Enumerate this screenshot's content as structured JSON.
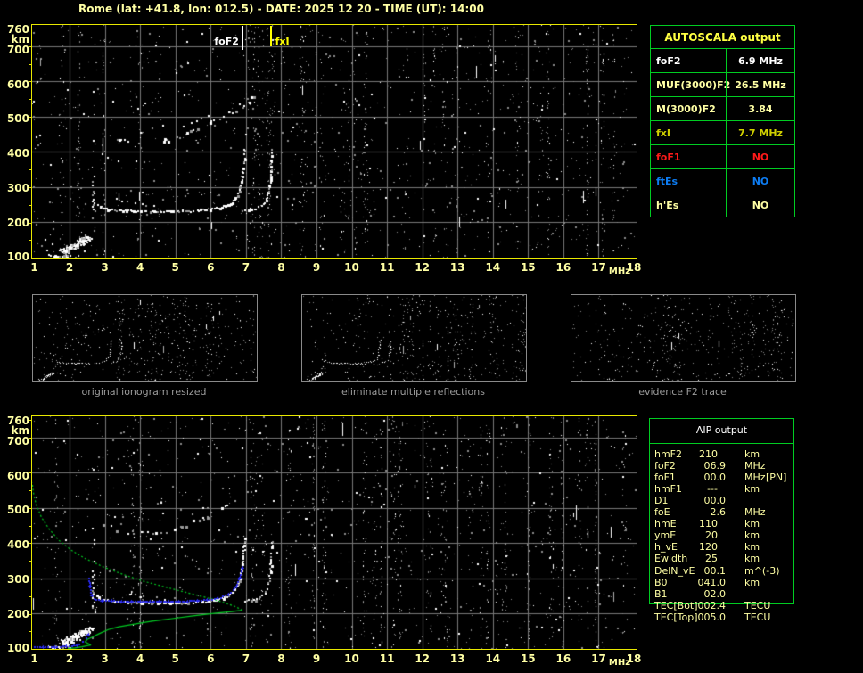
{
  "title": "Rome (lat: +41.8, lon: 012.5) - DATE: 2025 12 20 - TIME (UT): 14:00",
  "colors": {
    "background": "#000000",
    "panel_border": "#e8e800",
    "axis_label": "#ffffa4",
    "grid": "#787878",
    "table_border": "#00cc22",
    "profile_green": "#00cc22",
    "restored_blue": "#2a2af0",
    "caption_gray": "#9c9c9c",
    "thumb_border": "#8a8a8a",
    "trace_white": "#ffffff",
    "trace_gray": "#9a9a9a"
  },
  "autoscala_table": {
    "title": "AUTOSCALA output",
    "title_color": "#ffff42",
    "rows": [
      {
        "label": "foF2",
        "value": "6.9 MHz",
        "color": "#ffffff"
      },
      {
        "label": "MUF(3000)F2",
        "value": "26.5 MHz",
        "color": "#ffffa4"
      },
      {
        "label": "M(3000)F2",
        "value": "3.84",
        "color": "#ffffa4"
      },
      {
        "label": "fxI",
        "value": "7.7 MHz",
        "color": "#cfcf00"
      },
      {
        "label": "foF1",
        "value": "NO",
        "color": "#ff1a1a"
      },
      {
        "label": "ftEs",
        "value": "NO",
        "color": "#0d7cf2"
      },
      {
        "label": "h'Es",
        "value": "NO",
        "color": "#ffffa4"
      }
    ]
  },
  "aip_table": {
    "title": "AIP output",
    "rows": [
      {
        "label": "hmF2",
        "value": "210",
        "unit": "km",
        "note": ""
      },
      {
        "label": "foF2",
        "value": "06.9",
        "unit": "MHz",
        "note": ""
      },
      {
        "label": "foF1",
        "value": "00.0",
        "unit": "MHz",
        "note": "[PN]"
      },
      {
        "label": "hmF1",
        "value": "---",
        "unit": "km",
        "note": ""
      },
      {
        "label": "D1",
        "value": "00.0",
        "unit": "",
        "note": ""
      },
      {
        "label": "foE",
        "value": "2.6",
        "unit": "MHz",
        "note": ""
      },
      {
        "label": "hmE",
        "value": "110",
        "unit": "km",
        "note": ""
      },
      {
        "label": "ymE",
        "value": "20",
        "unit": "km",
        "note": ""
      },
      {
        "label": "h_vE",
        "value": "120",
        "unit": "km",
        "note": ""
      },
      {
        "label": "Ewidth",
        "value": "25",
        "unit": "km",
        "note": ""
      },
      {
        "label": "DelN_vE",
        "value": "00.1",
        "unit": "m^(-3)",
        "note": ""
      },
      {
        "label": "B0",
        "value": "041.0",
        "unit": "km",
        "note": ""
      },
      {
        "label": "B1",
        "value": "02.0",
        "unit": "",
        "note": ""
      },
      {
        "label": "TEC[Bot]",
        "value": "002.4",
        "unit": "TECU",
        "note": ""
      },
      {
        "label": "TEC[Top]",
        "value": "005.0",
        "unit": "TECU",
        "note": ""
      }
    ]
  },
  "thumbnails": [
    {
      "caption": "original ionogram resized",
      "show": [
        "e_line",
        "e_blob",
        "vert_spread",
        "f1_flat",
        "fx_trace",
        "f2_2hop"
      ],
      "noise": {
        "seed": 21,
        "base_density": 0.012,
        "columns": 22,
        "streaks": 6
      }
    },
    {
      "caption": "eliminate multiple reflections",
      "show": [
        "e_line",
        "e_blob",
        "vert_spread",
        "f1_flat",
        "fx_trace",
        "f2_2hop_sparse"
      ],
      "noise": {
        "seed": 33,
        "base_density": 0.012,
        "columns": 22,
        "streaks": 6
      }
    },
    {
      "caption": "evidence F2 trace",
      "show": [
        "frag_top",
        "frag_rise_o",
        "frag_rise_x",
        "frag_low"
      ],
      "noise": {
        "seed": 45,
        "base_density": 0.014,
        "columns": 16,
        "streaks": 3
      }
    }
  ],
  "traces": {
    "e_line": {
      "style": "solid",
      "points": [
        [
          1.42,
          107
        ],
        [
          1.65,
          105
        ],
        [
          1.9,
          105
        ],
        [
          2.08,
          106
        ]
      ]
    },
    "e_blob": {
      "style": "blob",
      "r": 5,
      "points": [
        [
          1.85,
          118
        ],
        [
          2.0,
          127
        ],
        [
          2.15,
          135
        ],
        [
          2.3,
          143
        ],
        [
          2.42,
          150
        ],
        [
          2.52,
          156
        ]
      ]
    },
    "vert_spread": {
      "style": "column",
      "x": 2.67,
      "from": 195,
      "to": 452,
      "dense_from": 204,
      "dense_to": 316
    },
    "f1_flat": {
      "style": "solid",
      "points": [
        [
          2.78,
          252
        ],
        [
          2.9,
          242
        ],
        [
          3.1,
          237
        ],
        [
          3.5,
          234
        ],
        [
          4.0,
          232
        ],
        [
          4.5,
          231
        ],
        [
          5.0,
          232
        ],
        [
          5.5,
          233
        ],
        [
          5.9,
          236
        ],
        [
          6.2,
          241
        ],
        [
          6.45,
          249
        ],
        [
          6.65,
          262
        ],
        [
          6.78,
          283
        ],
        [
          6.86,
          312
        ],
        [
          6.91,
          350
        ],
        [
          6.94,
          390
        ],
        [
          6.95,
          418
        ]
      ]
    },
    "f1_double": {
      "style": "sparse",
      "points": [
        [
          3.45,
          262
        ],
        [
          3.7,
          256
        ],
        [
          4.0,
          251
        ],
        [
          4.35,
          248
        ],
        [
          4.6,
          247
        ]
      ]
    },
    "fx_trace": {
      "style": "solid",
      "points": [
        [
          6.98,
          236
        ],
        [
          7.15,
          238
        ],
        [
          7.3,
          241
        ],
        [
          7.42,
          247
        ],
        [
          7.52,
          257
        ],
        [
          7.6,
          272
        ],
        [
          7.66,
          295
        ],
        [
          7.7,
          330
        ],
        [
          7.72,
          372
        ],
        [
          7.73,
          412
        ]
      ]
    },
    "f2_2hop": {
      "style": "patchy",
      "points": [
        [
          2.88,
          458
        ],
        [
          3.1,
          449
        ],
        [
          3.35,
          441
        ],
        [
          3.6,
          434
        ],
        [
          3.9,
          429
        ],
        [
          4.2,
          427
        ],
        [
          4.5,
          429
        ],
        [
          4.8,
          435
        ],
        [
          5.1,
          444
        ],
        [
          5.4,
          456
        ],
        [
          5.7,
          469
        ],
        [
          6.0,
          483
        ],
        [
          6.3,
          498
        ],
        [
          6.6,
          515
        ],
        [
          6.9,
          534
        ],
        [
          7.15,
          552
        ],
        [
          7.3,
          562
        ]
      ]
    },
    "f2_2hop_b": {
      "style": "sparse",
      "points": [
        [
          5.2,
          472
        ],
        [
          5.5,
          485
        ],
        [
          5.8,
          499
        ],
        [
          6.1,
          513
        ],
        [
          6.35,
          526
        ]
      ]
    },
    "f2_2hop_sparse": {
      "style": "sparse",
      "points": [
        [
          3.5,
          437
        ],
        [
          3.9,
          429
        ],
        [
          4.3,
          427
        ],
        [
          4.7,
          432
        ],
        [
          5.1,
          444
        ],
        [
          5.5,
          458
        ]
      ]
    },
    "frag_top": {
      "style": "sparse",
      "points": [
        [
          5.6,
          390
        ],
        [
          6.1,
          398
        ],
        [
          6.6,
          406
        ],
        [
          7.05,
          414
        ]
      ]
    },
    "frag_rise_o": {
      "style": "sparse",
      "points": [
        [
          7.0,
          150
        ],
        [
          7.1,
          185
        ],
        [
          7.2,
          222
        ],
        [
          7.3,
          258
        ],
        [
          7.36,
          292
        ]
      ]
    },
    "frag_rise_x": {
      "style": "sparse",
      "points": [
        [
          7.5,
          155
        ],
        [
          7.6,
          196
        ],
        [
          7.68,
          238
        ],
        [
          7.74,
          277
        ]
      ]
    },
    "frag_low": {
      "style": "sparse",
      "points": [
        [
          3.3,
          118
        ],
        [
          3.7,
          108
        ],
        [
          4.1,
          100
        ],
        [
          4.5,
          128
        ],
        [
          4.9,
          148
        ]
      ]
    }
  },
  "chart_data": [
    {
      "type": "scatter",
      "name": "recorded ionogram with AUTOSCALA frequency markers",
      "xlabel": "MHz",
      "ylabel": "km",
      "xlim": [
        1,
        18
      ],
      "ylim": [
        100,
        760
      ],
      "xticks": [
        1,
        2,
        3,
        4,
        5,
        6,
        7,
        8,
        9,
        10,
        11,
        12,
        13,
        14,
        15,
        16,
        17,
        18
      ],
      "yticks": [
        760,
        700,
        600,
        500,
        400,
        300,
        200,
        100
      ],
      "grid": true,
      "annotations": [
        {
          "label": "foF2",
          "mhz": 6.9,
          "color": "#ffffff",
          "side": "left"
        },
        {
          "label": "fxI",
          "mhz": 7.7,
          "color": "#ffff00",
          "side": "right"
        }
      ],
      "show": [
        "e_line",
        "e_blob",
        "vert_spread",
        "f1_flat",
        "f1_double",
        "fx_trace",
        "f2_2hop",
        "f2_2hop_b"
      ],
      "noise": {
        "seed": 7,
        "base_density": 0.006,
        "columns": 30,
        "streaks": 13
      }
    },
    {
      "type": "scatter",
      "name": "ionogram with restored trace (blue) and electron density profile (green)",
      "xlabel": "MHz",
      "ylabel": "km",
      "xlim": [
        1,
        18
      ],
      "ylim": [
        100,
        760
      ],
      "xticks": [
        1,
        2,
        3,
        4,
        5,
        6,
        7,
        8,
        9,
        10,
        11,
        12,
        13,
        14,
        15,
        16,
        17,
        18
      ],
      "yticks": [
        760,
        700,
        600,
        500,
        400,
        300,
        200,
        100
      ],
      "grid": true,
      "show": [
        "e_line",
        "e_blob",
        "vert_spread",
        "f1_flat",
        "f1_double",
        "fx_trace",
        "f2_2hop",
        "f2_2hop_b"
      ],
      "profile": {
        "color": "#00cc22",
        "bottomside": [
          [
            1.95,
            101
          ],
          [
            2.15,
            103
          ],
          [
            2.35,
            106
          ],
          [
            2.5,
            109
          ],
          [
            2.6,
            111
          ],
          [
            2.53,
            115
          ],
          [
            2.44,
            120
          ],
          [
            2.5,
            127
          ],
          [
            2.63,
            133
          ],
          [
            2.85,
            144
          ],
          [
            3.1,
            155
          ],
          [
            3.4,
            163
          ],
          [
            3.8,
            170
          ],
          [
            4.3,
            178
          ],
          [
            4.9,
            186
          ],
          [
            5.5,
            194
          ],
          [
            6.1,
            201
          ],
          [
            6.6,
            206
          ],
          [
            6.9,
            210
          ]
        ],
        "topside": [
          [
            6.9,
            210
          ],
          [
            6.7,
            220
          ],
          [
            6.45,
            229
          ],
          [
            6.1,
            240
          ],
          [
            5.7,
            250
          ],
          [
            5.2,
            263
          ],
          [
            4.7,
            276
          ],
          [
            4.1,
            292
          ],
          [
            3.5,
            312
          ],
          [
            2.95,
            333
          ],
          [
            2.45,
            356
          ],
          [
            2.05,
            380
          ],
          [
            1.7,
            408
          ],
          [
            1.42,
            440
          ],
          [
            1.2,
            474
          ],
          [
            1.05,
            510
          ],
          [
            0.97,
            545
          ],
          [
            0.94,
            572
          ]
        ]
      },
      "restored_trace": {
        "color": "#2a2af0",
        "segments": [
          [
            [
              1.02,
              104
            ],
            [
              1.25,
              104
            ],
            [
              1.5,
              104
            ],
            [
              1.75,
              105
            ],
            [
              2.0,
              106
            ],
            [
              2.15,
              108
            ],
            [
              2.3,
              112
            ],
            [
              2.4,
              119
            ],
            [
              2.48,
              129
            ],
            [
              2.54,
              140
            ],
            [
              2.58,
              151
            ]
          ],
          [
            [
              2.56,
              298
            ],
            [
              2.6,
              272
            ],
            [
              2.64,
              250
            ],
            [
              2.71,
              240
            ],
            [
              2.84,
              237
            ],
            [
              3.05,
              235
            ],
            [
              3.35,
              234
            ],
            [
              3.75,
              233
            ],
            [
              4.15,
              233
            ],
            [
              4.55,
              233
            ],
            [
              4.95,
              233
            ],
            [
              5.35,
              234
            ],
            [
              5.75,
              236
            ],
            [
              6.05,
              239
            ],
            [
              6.3,
              244
            ],
            [
              6.5,
              253
            ],
            [
              6.65,
              265
            ],
            [
              6.77,
              281
            ],
            [
              6.85,
              302
            ],
            [
              6.9,
              322
            ],
            [
              6.93,
              338
            ]
          ]
        ]
      },
      "noise": {
        "seed": 13,
        "base_density": 0.006,
        "columns": 30,
        "streaks": 12
      }
    }
  ]
}
